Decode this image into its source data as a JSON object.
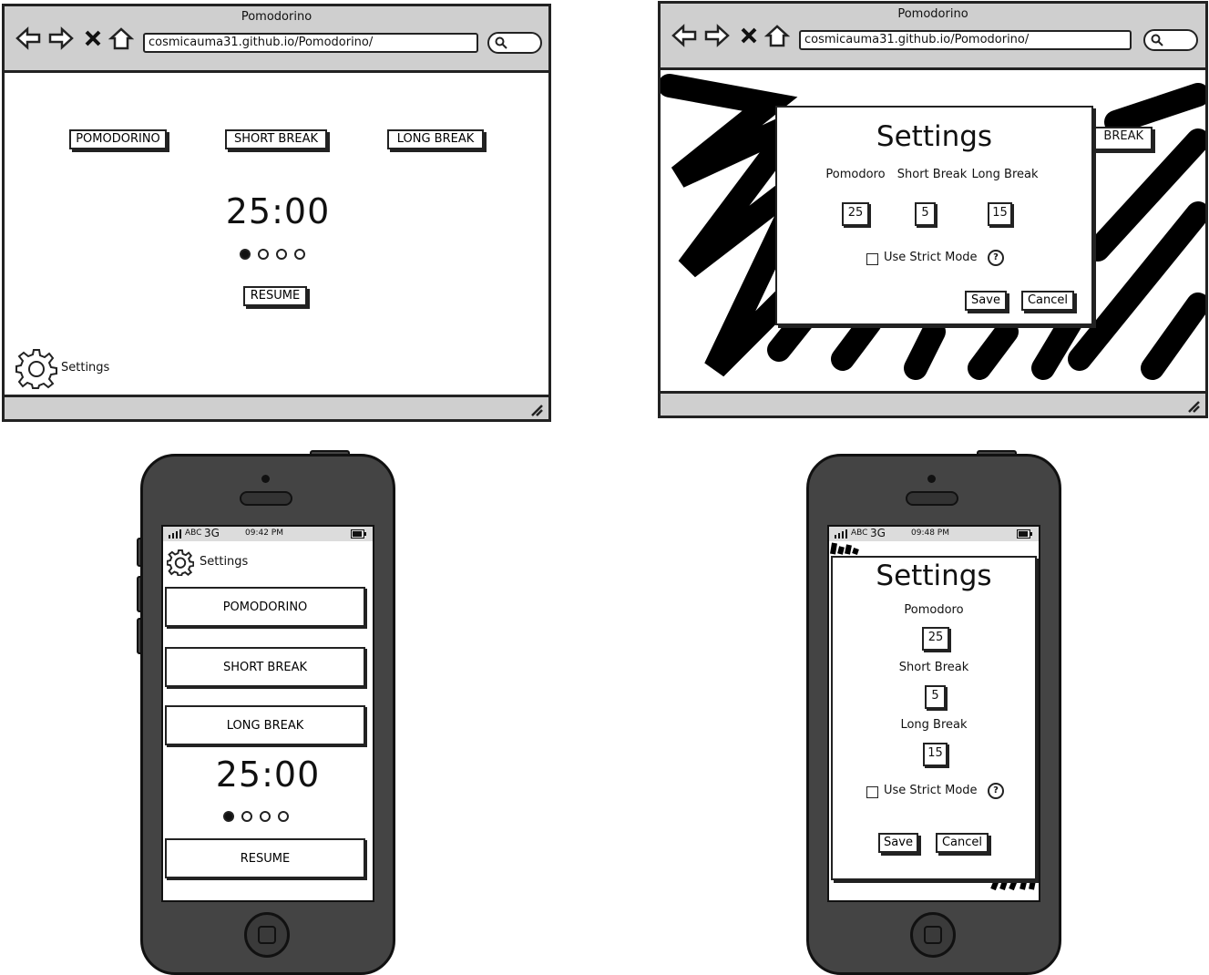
{
  "browser": {
    "title": "Pomodorino",
    "url": "cosmicauma31.github.io/Pomodorino/"
  },
  "modes": {
    "pomodoro": "POMODORINO",
    "short": "SHORT BREAK",
    "long": "LONG BREAK"
  },
  "timer": "25:00",
  "session_dots": {
    "filled": 1,
    "total": 4
  },
  "resume_label": "RESUME",
  "settings_link": "Settings",
  "obscured_tab_text": "BREAK",
  "settings_dialog": {
    "title": "Settings",
    "pomodoro_label": "Pomodoro",
    "short_label": "Short Break",
    "long_label": "Long Break",
    "pomodoro_value": "25",
    "short_value": "5",
    "long_value": "15",
    "strict_label": "Use Strict Mode",
    "help_glyph": "?",
    "save_label": "Save",
    "cancel_label": "Cancel"
  },
  "phone_status_1": {
    "carrier": "ABC",
    "network": "3G",
    "time": "09:42 PM"
  },
  "phone_status_2": {
    "carrier": "ABC",
    "network": "3G",
    "time": "09:48 PM"
  },
  "icons": [
    "back-arrow-icon",
    "forward-arrow-icon",
    "close-x-icon",
    "home-icon",
    "search-icon",
    "resize-grip-icon",
    "gear-icon",
    "signal-icon",
    "battery-icon",
    "help-icon"
  ],
  "colors": {
    "chrome": "#cfcfcf",
    "ink": "#222222",
    "phone_body": "#444444"
  }
}
